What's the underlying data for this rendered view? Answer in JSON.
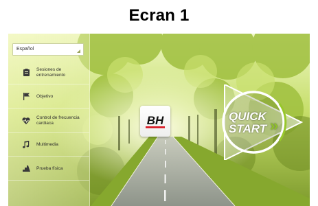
{
  "caption": "Ecran 1",
  "language_select": {
    "value": "Español"
  },
  "menu": [
    {
      "label": "Sesiones de\nentrenamiento",
      "icon": "clipboard-icon"
    },
    {
      "label": "Objetivo",
      "icon": "flag-icon"
    },
    {
      "label": "Control de frecuencia\ncardiaca",
      "icon": "heart-rate-icon"
    },
    {
      "label": "Multimedia",
      "icon": "music-note-icon"
    },
    {
      "label": "Prueba física",
      "icon": "stairs-icon"
    }
  ],
  "logo": {
    "text": "BH"
  },
  "quick_start": {
    "line1": "QUICK",
    "line2": "START",
    "chevrons": "»"
  },
  "colors": {
    "foliage": "#a7c24a",
    "road": "#9ea39a",
    "logo_red": "#d8121f",
    "quick_start_arrow": "#ffffff"
  }
}
